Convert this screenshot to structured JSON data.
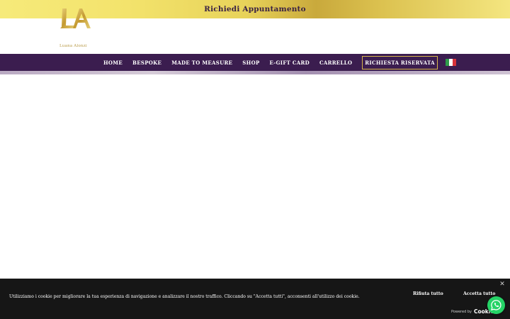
{
  "topbar": {
    "cta_label": "Richiedi Appuntamento"
  },
  "brand": {
    "logo_letters": "LA",
    "logo_name": "Luana Alonzi"
  },
  "nav": {
    "items": [
      {
        "label": "HOME"
      },
      {
        "label": "BESPOKE"
      },
      {
        "label": "MADE TO MEASURE"
      },
      {
        "label": "SHOP"
      },
      {
        "label": "E-GIFT CARD"
      },
      {
        "label": "CARRELLO"
      },
      {
        "label": "RICHIESTA RISERVATA"
      }
    ],
    "language_icon": "italy-flag-icon"
  },
  "cookie_banner": {
    "message": "Utilizziamo i cookie per migliorare la tua esperienza di navigazione e analizzare il nostro traffico. Cliccando su \"Accetta tutti\", acconsenti all'utilizzo dei cookie.",
    "reject_label": "Rifiuta tutto",
    "accept_label": "Accetta tutto",
    "powered_by_label": "Powered by",
    "powered_by_brand": "Cookie",
    "close_icon": "close-icon"
  },
  "floating": {
    "whatsapp_icon": "whatsapp-icon"
  },
  "colors": {
    "nav_bg": "#3b1d4f",
    "gold": "#d7b64a",
    "cookie_bg": "#161616",
    "whatsapp": "#25d366"
  }
}
